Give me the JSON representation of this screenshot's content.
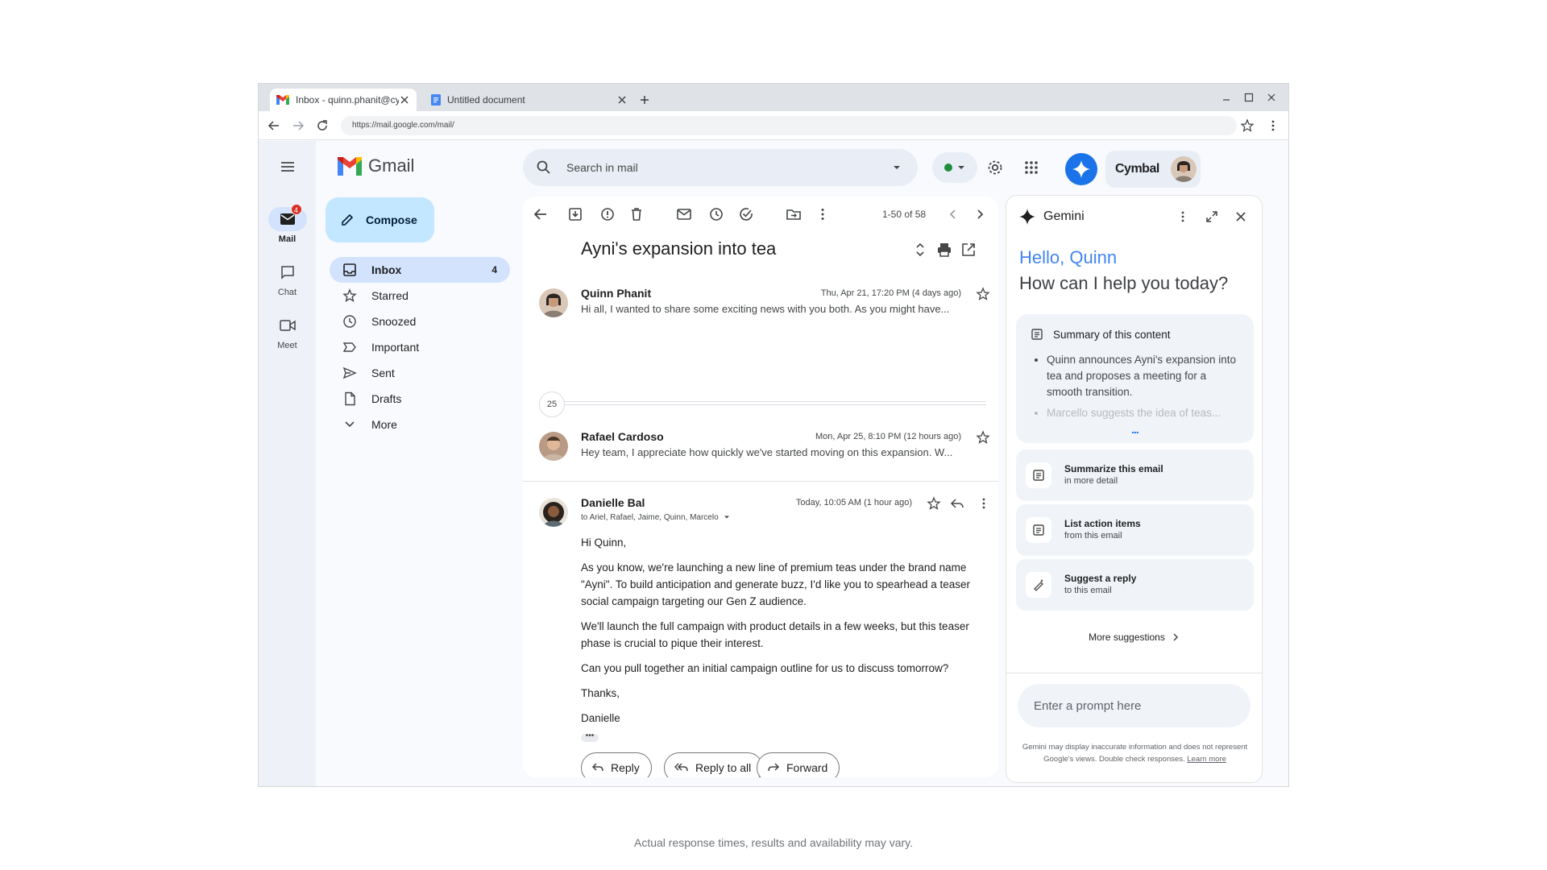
{
  "browser": {
    "tabs": [
      {
        "label": "Inbox - quinn.phanit@cymbal",
        "active": true
      },
      {
        "label": "Untitled document",
        "active": false
      }
    ],
    "url": "https://mail.google.com/mail/"
  },
  "rail": {
    "items": [
      {
        "label": "Mail",
        "badge": "4",
        "icon": "mail-icon"
      },
      {
        "label": "Chat",
        "icon": "chat-icon"
      },
      {
        "label": "Meet",
        "icon": "video-icon"
      }
    ]
  },
  "logo_text": "Gmail",
  "compose_label": "Compose",
  "nav": [
    {
      "label": "Inbox",
      "count": "4",
      "icon": "inbox-icon"
    },
    {
      "label": "Starred",
      "icon": "star-icon"
    },
    {
      "label": "Snoozed",
      "icon": "clock-icon"
    },
    {
      "label": "Important",
      "icon": "label-important-icon"
    },
    {
      "label": "Sent",
      "icon": "send-icon"
    },
    {
      "label": "Drafts",
      "icon": "draft-icon"
    },
    {
      "label": "More",
      "icon": "chevron-down-icon"
    }
  ],
  "search": {
    "placeholder": "Search in mail"
  },
  "account": {
    "brand": "Cymbal"
  },
  "toolbar": {
    "page_count": "1-50 of 58"
  },
  "thread": {
    "subject": "Ayni's expansion into tea",
    "collapsed_count": "25",
    "messages": [
      {
        "sender": "Quinn Phanit",
        "time": "Thu, Apr 21, 17:20 PM (4 days ago)",
        "snippet": "Hi all, I wanted to share some exciting news with you both. As you might have..."
      },
      {
        "sender": "Rafael Cardoso",
        "time": "Mon, Apr 25, 8:10 PM (12 hours ago)",
        "snippet": "Hey team, I appreciate how quickly we've started moving on this expansion. W..."
      },
      {
        "sender": "Danielle Bal",
        "time": "Today, 10:05 AM (1 hour ago)",
        "recipients": "to Ariel, Rafael, Jaime, Quinn, Marcelo"
      }
    ],
    "body": [
      "Hi Quinn,",
      "As you know, we're launching a new line of premium teas under the brand name \"Ayni\". To build anticipation and generate buzz, I'd like you to spearhead a teaser social campaign targeting our Gen Z audience.",
      "We'll launch the full campaign with product details in a few weeks, but this teaser phase is crucial to pique their interest.",
      "Can you pull together an initial campaign outline for us to discuss tomorrow?",
      "Thanks,",
      "Danielle"
    ],
    "actions": {
      "reply": "Reply",
      "reply_all": "Reply to all",
      "forward": "Forward"
    }
  },
  "gemini": {
    "title": "Gemini",
    "hello": "Hello, Quinn",
    "help": "How can I help you today?",
    "summary_title": "Summary of this content",
    "summary_items": [
      "Quinn announces Ayni's expansion into tea and proposes a meeting for a smooth transition.",
      "Marcello suggests the idea of teas..."
    ],
    "summary_more": "...",
    "suggestions": [
      {
        "title": "Summarize this email",
        "sub": "in more detail",
        "icon": "summarize-icon"
      },
      {
        "title": "List action items",
        "sub": "from this email",
        "icon": "list-icon"
      },
      {
        "title": "Suggest a reply",
        "sub": "to this email",
        "icon": "magic-pen-icon"
      }
    ],
    "more_suggestions": "More suggestions",
    "prompt_placeholder": "Enter a prompt here",
    "disclaimer": "Gemini may display inaccurate information and does not represent Google's views. Double check responses.",
    "learn_more": "Learn more"
  },
  "footnote": "Actual response times, results and availability may vary.",
  "colors": {
    "accent": "#1a73e8",
    "compose_bg": "#c2e7ff",
    "nav_active": "#d3e3fd",
    "badge": "#d93025",
    "hello": "#4285f4"
  }
}
